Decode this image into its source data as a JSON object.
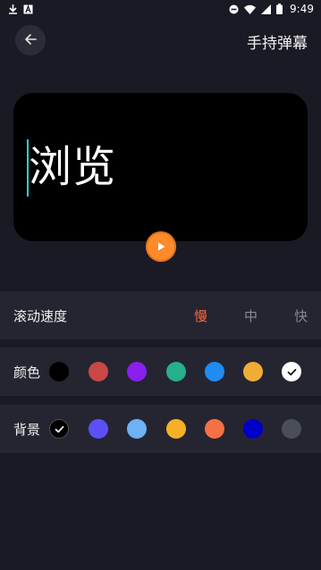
{
  "status_bar": {
    "time": "9:49",
    "left_icons": [
      "download-icon",
      "text-a-icon"
    ],
    "right_icons": [
      "do-not-disturb-icon",
      "wifi-icon",
      "signal-icon",
      "battery-icon"
    ]
  },
  "header": {
    "title": "手持弹幕",
    "back_icon": "arrow-left-icon"
  },
  "preview": {
    "text": "浏览",
    "background": "#000000",
    "text_color": "#ffffff",
    "caret_color": "#2ad0d0"
  },
  "play_button": {
    "icon": "play-icon",
    "color": "#ff8a2a"
  },
  "speed": {
    "label": "滚动速度",
    "options": [
      "慢",
      "中",
      "快"
    ],
    "selected": "慢",
    "selected_color": "#ff6a3d",
    "unselected_color": "#8a8a96"
  },
  "color_row": {
    "label": "颜色",
    "swatches": [
      "#000000",
      "#c94747",
      "#8a1ff0",
      "#26b08a",
      "#1e8cf0",
      "#f0ad35",
      "#ffffff"
    ],
    "selected_index": 6
  },
  "background_row": {
    "label": "背景",
    "swatches": [
      "#000000",
      "#5a50f5",
      "#6cb2f5",
      "#f5b025",
      "#f57045",
      "#0000c8",
      "#4a4e58"
    ],
    "selected_index": 0
  }
}
